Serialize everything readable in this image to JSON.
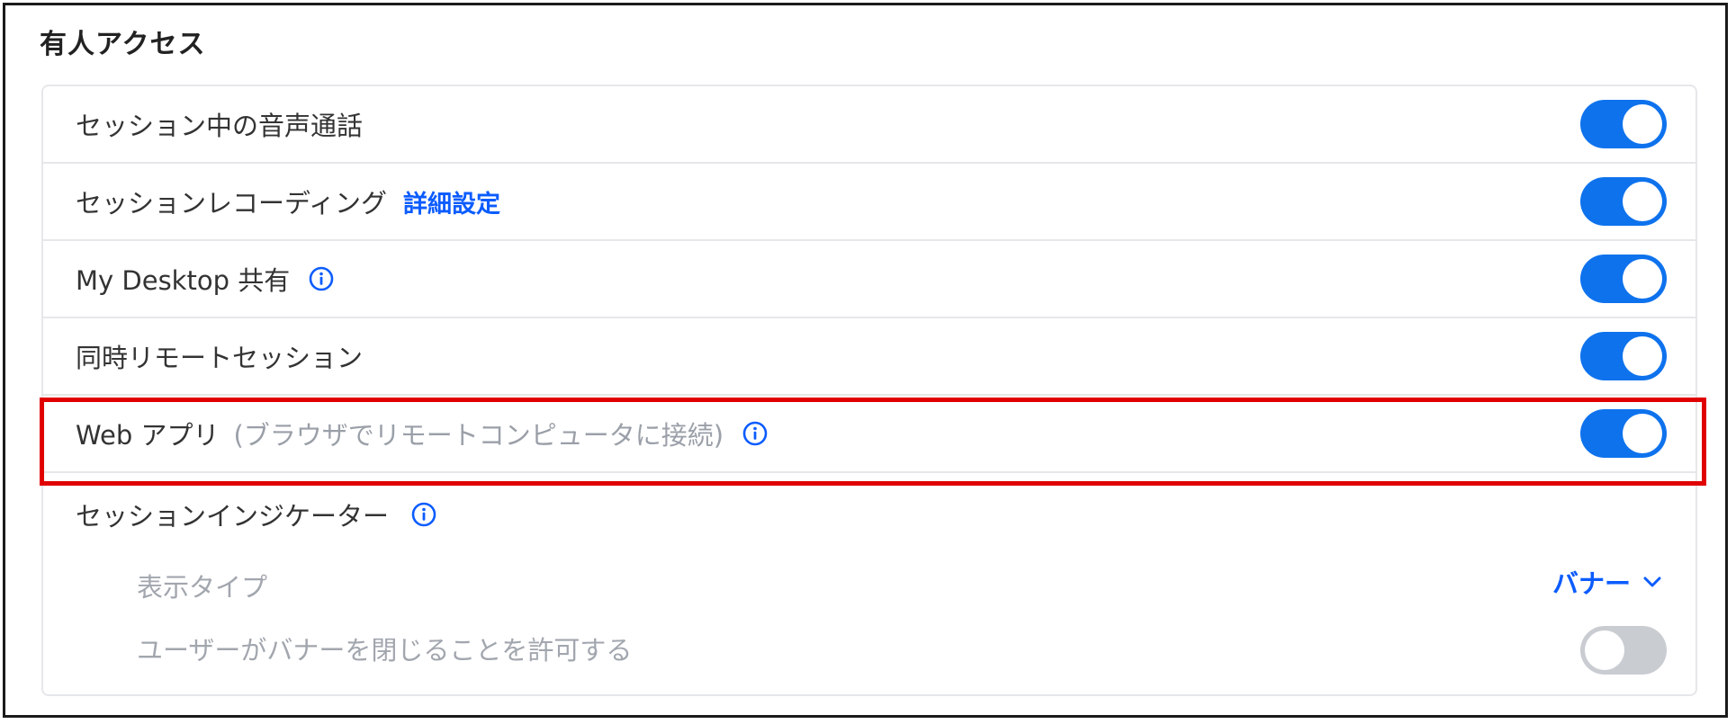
{
  "section": {
    "title": "有人アクセス"
  },
  "rows": [
    {
      "label": "セッション中の音声通話",
      "enabled": true
    },
    {
      "label": "セッションレコーディング",
      "link": "詳細設定",
      "enabled": true
    },
    {
      "label": "My Desktop 共有",
      "info_icon": "info-icon",
      "enabled": true
    },
    {
      "label": "同時リモートセッション",
      "enabled": true
    },
    {
      "label": "Web アプリ",
      "hint": "(ブラウザでリモートコンピュータに接続)",
      "info_icon": "info-icon",
      "enabled": true
    }
  ],
  "indicator": {
    "label": "セッションインジケーター",
    "info_icon": "info-icon",
    "display_type": {
      "label": "表示タイプ",
      "value": "バナー"
    },
    "allow_close": {
      "label": "ユーザーがバナーを閉じることを許可する",
      "enabled": false
    }
  },
  "colors": {
    "accent": "#0e72ed",
    "link": "#0b5cff",
    "highlight": "#e00000",
    "toggle_off": "#c9ccd1"
  }
}
